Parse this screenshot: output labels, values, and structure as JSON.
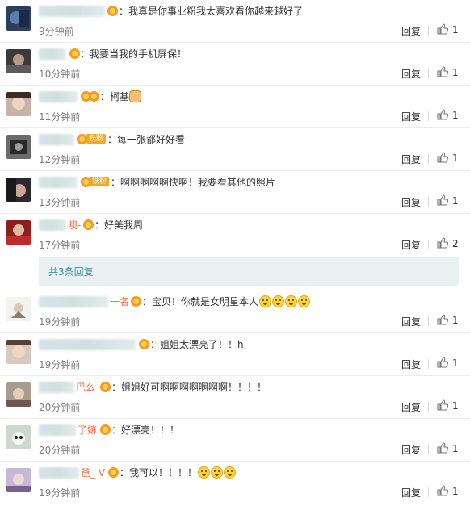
{
  "comments": [
    {
      "name_tail": "",
      "badge": "v",
      "text": "：我真是你事业粉我太喜欢看你越来越好了",
      "emoji": [],
      "time": "9分钟前",
      "likes": "1"
    },
    {
      "name_tail": "",
      "badge": "v",
      "text": "：我要当我的手机屏保！",
      "emoji": [],
      "time": "10分钟前",
      "likes": "1"
    },
    {
      "name_tail": "",
      "badge": "v",
      "text": "：柯基",
      "emoji": [
        "dog-emoji"
      ],
      "time": "11分钟前",
      "likes": "1"
    },
    {
      "name_tail": "",
      "badge": "铁粉",
      "text": "：每一张都好好看",
      "emoji": [],
      "time": "12分钟前",
      "likes": "1"
    },
    {
      "name_tail": "",
      "badge": "铁粉",
      "text": "：啊啊啊啊啊快啊！我要看其他的照片",
      "emoji": [],
      "time": "13分钟前",
      "likes": "1"
    },
    {
      "name_tail": "噢-",
      "badge": "v",
      "text": "：好美我周",
      "emoji": [],
      "time": "17分钟前",
      "likes": "2"
    },
    {
      "name_tail": "一名",
      "badge": "v",
      "text": "：宝贝！你就是女明星本人",
      "emoji": [
        "face-emoji",
        "face-emoji",
        "face-emoji",
        "face-emoji"
      ],
      "time": "19分钟前",
      "likes": "1"
    },
    {
      "name_tail": "",
      "badge": "v",
      "text": "：姐姐太漂亮了！！h",
      "emoji": [],
      "time": "19分钟前",
      "likes": "1"
    },
    {
      "name_tail": "巴么",
      "badge": "v",
      "text": "：姐姐好可啊啊啊啊啊啊啊！！！！",
      "emoji": [],
      "time": "20分钟前",
      "likes": "1"
    },
    {
      "name_tail": "了嫲",
      "badge": "v",
      "text": "：好漂亮！！！",
      "emoji": [],
      "time": "20分钟前",
      "likes": "1"
    },
    {
      "name_tail": "爸_ V",
      "badge": "v",
      "text": "：我可以！！！！",
      "emoji": [
        "face-emoji",
        "face-emoji",
        "face-emoji"
      ],
      "time": "19分钟前",
      "likes": "1"
    }
  ],
  "reply_label": "回复",
  "sub_replies_label": "共3条回复",
  "colors": {
    "name": "#eb7350",
    "link": "#3e8ea0",
    "sub_bg": "#eaf1f2"
  }
}
